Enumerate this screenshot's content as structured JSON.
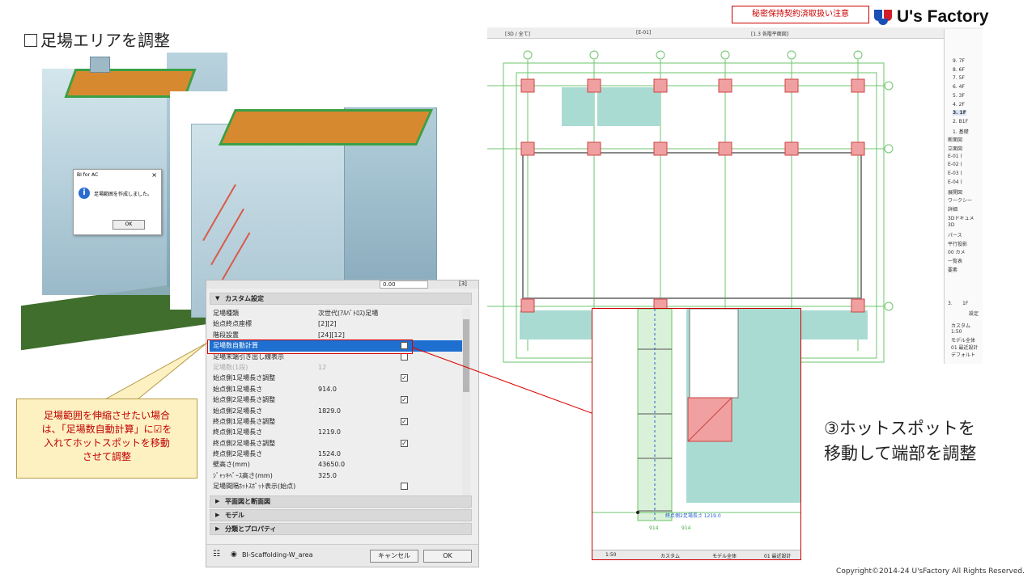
{
  "header": {
    "title": "足場エリアを調整",
    "confidential": "秘密保持契約済取扱い注意",
    "brand": "U's Factory"
  },
  "footer": {
    "copyright": "Copyright©2014-24 U'sFactory All Rights Reserved."
  },
  "dialog": {
    "title": "BI for AC",
    "close": "×",
    "info_icon_glyph": "i",
    "message": "足場範囲を作成しました。",
    "ok_label": "OK"
  },
  "panel": {
    "top_value": "0.00",
    "top_right": "[3]",
    "section_custom": "カスタム設定",
    "rows": [
      {
        "k": "足場種類",
        "v": "次世代(ｱﾙﾊﾞﾄﾛｽ)足場"
      },
      {
        "k": "始点終点座標",
        "v": "[2][2]"
      },
      {
        "k": "階段設置",
        "v": "[24][12]"
      },
      {
        "k": "足場数自動計算",
        "check": "✓",
        "sel": true
      },
      {
        "k": "足場末端引き出し線表示",
        "check": ""
      },
      {
        "k": "足場数(1段)",
        "v": "12",
        "dim": true
      },
      {
        "k": "始点側1足場長さ調整",
        "check": "✓"
      },
      {
        "k": "始点側1足場長さ",
        "v": "914.0"
      },
      {
        "k": "始点側2足場長さ調整",
        "check": "✓"
      },
      {
        "k": "始点側2足場長さ",
        "v": "1829.0"
      },
      {
        "k": "終点側1足場長さ調整",
        "check": "✓"
      },
      {
        "k": "終点側1足場長さ",
        "v": "1219.0"
      },
      {
        "k": "終点側2足場長さ調整",
        "check": "✓"
      },
      {
        "k": "終点側2足場長さ",
        "v": "1524.0"
      },
      {
        "k": "壁高さ(mm)",
        "v": "43650.0"
      },
      {
        "k": "ｼﾞｬｯｷﾍﾞｰｽ高さ(mm)",
        "v": "325.0"
      },
      {
        "k": "足場間隔ﾎｯﾄｽﾎﾟｯﾄ表示(始点)",
        "check": ""
      }
    ],
    "section_plan": "平面図と断面図",
    "section_model": "モデル",
    "section_class": "分類とプロパティ",
    "favorite_name": "BI-Scaffolding-W_area",
    "cancel_label": "キャンセル",
    "ok_label": "OK"
  },
  "note": {
    "lines": [
      "足場範囲を伸縮させたい場合",
      "は、「足場数自動計算」に☑を",
      "入れてホットスポットを移動",
      "させて調整"
    ]
  },
  "plan": {
    "tabs": [
      "[3D / 全て]",
      "[E-01]",
      "[1.3 各階平面図]"
    ],
    "nav_items": [
      "9. 7F",
      "8. 6F",
      "7. 5F",
      "6. 4F",
      "5. 3F",
      "4. 2F",
      "3. 1F",
      "2. B1F",
      "1. 基礎",
      "断面図",
      "立面図",
      "E-01 (",
      "E-02 (",
      "E-03 (",
      "E-04 (",
      "展開図",
      "ワークシー",
      "詳細",
      "3Dドキュメ",
      "3D",
      "パース",
      "平行投影",
      "00 カメ",
      "一覧表",
      "要素"
    ],
    "nav_selected": "3. 1F",
    "info_floor": "3.",
    "info_value": "1F",
    "info_button": "設定",
    "bottom_items": [
      "カスタム",
      "1:50",
      "モデル全体",
      "01 最近設計",
      "デフォルト"
    ]
  },
  "zoom": {
    "label_main": "終点側2足場長さ 1219.0",
    "dim1": "914",
    "dim2": "914",
    "status": [
      "1:50",
      "カスタム",
      "モデル全体",
      "01 最近設計"
    ]
  },
  "caption": {
    "lines": [
      "③ホットスポットを",
      "移動して端部を調整"
    ]
  }
}
